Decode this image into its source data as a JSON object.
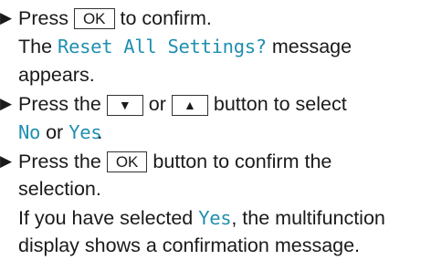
{
  "steps": [
    {
      "bullet": "▶",
      "l1_pre": "Press",
      "l1_key": "OK",
      "l1_post": "to confirm.",
      "l2_pre": "The",
      "l2_message": "Reset All Settings?",
      "l2_post": "message",
      "l3": "appears."
    },
    {
      "bullet": "▶",
      "l1_pre": "Press the",
      "key_down": "▼",
      "l1_mid": "or",
      "key_up": "▲",
      "l1_post": "button to select",
      "opt_no": "No",
      "l2_mid": "or",
      "opt_yes": "Yes",
      "l2_end": "."
    },
    {
      "bullet": "▶",
      "l1_pre": "Press the",
      "l1_key": "OK",
      "l1_post": "button to confirm the",
      "l2": "selection.",
      "l3_pre": "If you have selected",
      "l3_yes": "Yes",
      "l3_post": ", the multifunction",
      "l4": "display shows a confirmation message."
    }
  ]
}
